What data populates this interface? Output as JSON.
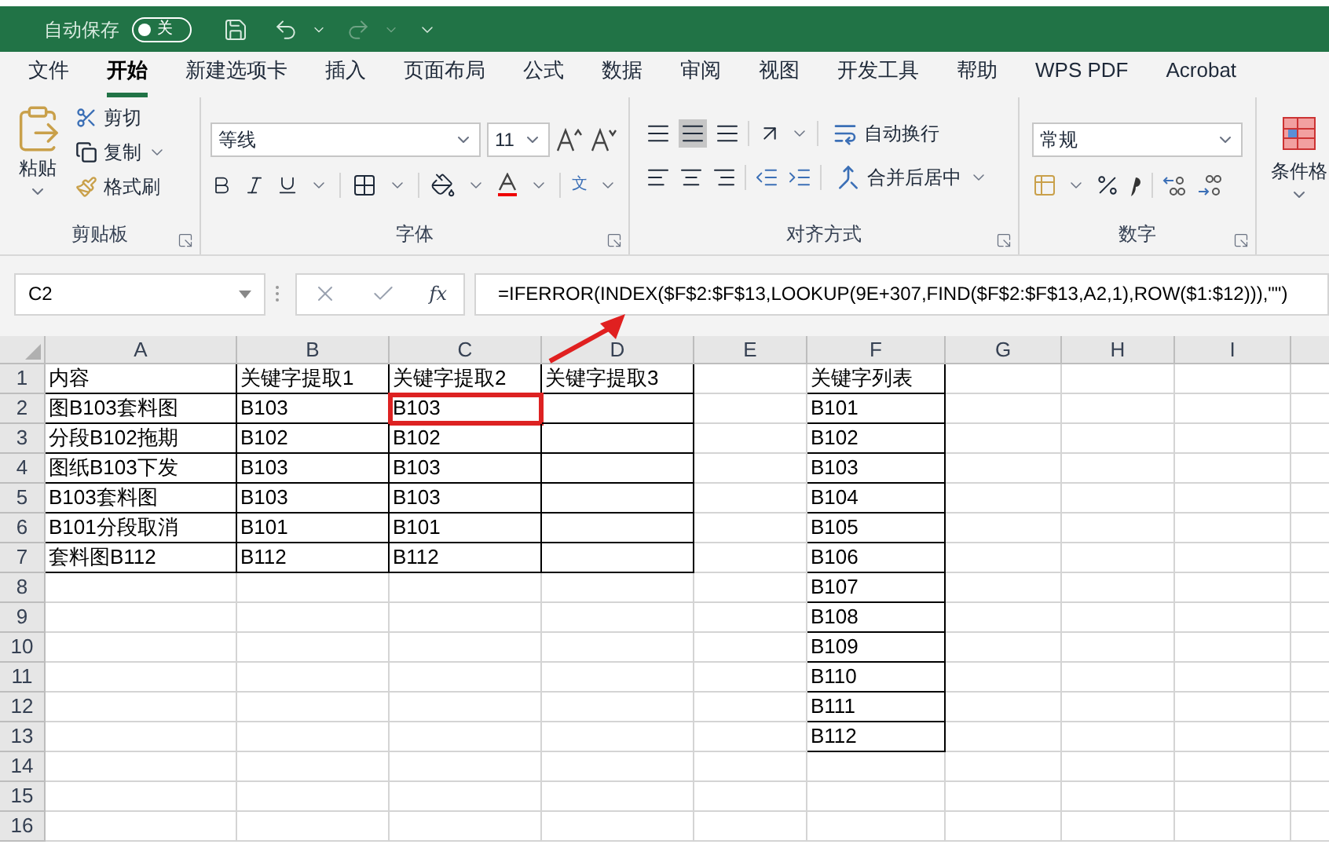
{
  "title_bar": {
    "autosave_label": "自动保存",
    "autosave_toggle": {
      "on": false,
      "label": "关"
    }
  },
  "ribbon_tabs": [
    {
      "label": "文件",
      "selected": false
    },
    {
      "label": "开始",
      "selected": true
    },
    {
      "label": "新建选项卡",
      "selected": false
    },
    {
      "label": "插入",
      "selected": false
    },
    {
      "label": "页面布局",
      "selected": false
    },
    {
      "label": "公式",
      "selected": false
    },
    {
      "label": "数据",
      "selected": false
    },
    {
      "label": "审阅",
      "selected": false
    },
    {
      "label": "视图",
      "selected": false
    },
    {
      "label": "开发工具",
      "selected": false
    },
    {
      "label": "帮助",
      "selected": false
    },
    {
      "label": "WPS PDF",
      "selected": false
    },
    {
      "label": "Acrobat",
      "selected": false
    }
  ],
  "clipboard_group": {
    "title": "剪贴板",
    "paste": "粘贴",
    "cut": "剪切",
    "copy": "复制",
    "format_painter": "格式刷"
  },
  "font_group": {
    "title": "字体",
    "font_name": "等线",
    "font_size": "11",
    "phonetic_label": "文"
  },
  "alignment_group": {
    "title": "对齐方式",
    "wrap_text": "自动换行",
    "merge_center": "合并后居中"
  },
  "number_group": {
    "title": "数字",
    "format": "常规"
  },
  "styles_group": {
    "conditional_format": "条件格"
  },
  "formula_bar": {
    "name_box": "C2",
    "function_label": "fx",
    "formula": "=IFERROR(INDEX($F$2:$F$13,LOOKUP(9E+307,FIND($F$2:$F$13,A2,1),ROW($1:$12))),\"\")"
  },
  "sheet": {
    "columns": [
      "A",
      "B",
      "C",
      "D",
      "E",
      "F",
      "G",
      "H",
      "I"
    ],
    "rows": [
      {
        "number": "1",
        "cells": [
          {
            "text": "内容",
            "boxed": true,
            "highlighted": false
          },
          {
            "text": "关键字提取1",
            "boxed": true,
            "highlighted": false
          },
          {
            "text": "关键字提取2",
            "boxed": true,
            "highlighted": false
          },
          {
            "text": "关键字提取3",
            "boxed": true,
            "highlighted": false
          },
          {
            "boxed": false,
            "highlighted": false
          },
          {
            "text": "关键字列表",
            "boxed": true,
            "highlighted": false
          }
        ]
      },
      {
        "number": "2",
        "cells": [
          {
            "text": "图B103套料图",
            "boxed": true,
            "highlighted": false
          },
          {
            "text": "B103",
            "boxed": true,
            "highlighted": false
          },
          {
            "text": "B103",
            "boxed": true,
            "highlighted": true
          },
          {
            "boxed": true,
            "highlighted": false
          },
          {
            "boxed": false,
            "highlighted": false
          },
          {
            "text": "B101",
            "boxed": true,
            "highlighted": false
          }
        ]
      },
      {
        "number": "3",
        "cells": [
          {
            "text": "分段B102拖期",
            "boxed": true,
            "highlighted": false
          },
          {
            "text": "B102",
            "boxed": true,
            "highlighted": false
          },
          {
            "text": "B102",
            "boxed": true,
            "highlighted": false
          },
          {
            "boxed": true,
            "highlighted": false
          },
          {
            "boxed": false,
            "highlighted": false
          },
          {
            "text": "B102",
            "boxed": true,
            "highlighted": false
          }
        ]
      },
      {
        "number": "4",
        "cells": [
          {
            "text": "图纸B103下发",
            "boxed": true,
            "highlighted": false
          },
          {
            "text": "B103",
            "boxed": true,
            "highlighted": false
          },
          {
            "text": "B103",
            "boxed": true,
            "highlighted": false
          },
          {
            "boxed": true,
            "highlighted": false
          },
          {
            "boxed": false,
            "highlighted": false
          },
          {
            "text": "B103",
            "boxed": true,
            "highlighted": false
          }
        ]
      },
      {
        "number": "5",
        "cells": [
          {
            "text": "B103套料图",
            "boxed": true,
            "highlighted": false
          },
          {
            "text": "B103",
            "boxed": true,
            "highlighted": false
          },
          {
            "text": "B103",
            "boxed": true,
            "highlighted": false
          },
          {
            "boxed": true,
            "highlighted": false
          },
          {
            "boxed": false,
            "highlighted": false
          },
          {
            "text": "B104",
            "boxed": true,
            "highlighted": false
          }
        ]
      },
      {
        "number": "6",
        "cells": [
          {
            "text": "B101分段取消",
            "boxed": true,
            "highlighted": false
          },
          {
            "text": "B101",
            "boxed": true,
            "highlighted": false
          },
          {
            "text": "B101",
            "boxed": true,
            "highlighted": false
          },
          {
            "boxed": true,
            "highlighted": false
          },
          {
            "boxed": false,
            "highlighted": false
          },
          {
            "text": "B105",
            "boxed": true,
            "highlighted": false
          }
        ]
      },
      {
        "number": "7",
        "cells": [
          {
            "text": "套料图B112",
            "boxed": true,
            "highlighted": false
          },
          {
            "text": "B112",
            "boxed": true,
            "highlighted": false
          },
          {
            "text": "B112",
            "boxed": true,
            "highlighted": false
          },
          {
            "boxed": true,
            "highlighted": false
          },
          {
            "boxed": false,
            "highlighted": false
          },
          {
            "text": "B106",
            "boxed": true,
            "highlighted": false
          }
        ]
      },
      {
        "number": "8",
        "cells": [
          {
            "boxed": false,
            "highlighted": false
          },
          {
            "boxed": false,
            "highlighted": false
          },
          {
            "boxed": false,
            "highlighted": false
          },
          {
            "boxed": false,
            "highlighted": false
          },
          {
            "boxed": false,
            "highlighted": false
          },
          {
            "text": "B107",
            "boxed": true,
            "highlighted": false
          }
        ]
      },
      {
        "number": "9",
        "cells": [
          {
            "boxed": false,
            "highlighted": false
          },
          {
            "boxed": false,
            "highlighted": false
          },
          {
            "boxed": false,
            "highlighted": false
          },
          {
            "boxed": false,
            "highlighted": false
          },
          {
            "boxed": false,
            "highlighted": false
          },
          {
            "text": "B108",
            "boxed": true,
            "highlighted": false
          }
        ]
      },
      {
        "number": "10",
        "cells": [
          {
            "boxed": false,
            "highlighted": false
          },
          {
            "boxed": false,
            "highlighted": false
          },
          {
            "boxed": false,
            "highlighted": false
          },
          {
            "boxed": false,
            "highlighted": false
          },
          {
            "boxed": false,
            "highlighted": false
          },
          {
            "text": "B109",
            "boxed": true,
            "highlighted": false
          }
        ]
      },
      {
        "number": "11",
        "cells": [
          {
            "boxed": false,
            "highlighted": false
          },
          {
            "boxed": false,
            "highlighted": false
          },
          {
            "boxed": false,
            "highlighted": false
          },
          {
            "boxed": false,
            "highlighted": false
          },
          {
            "boxed": false,
            "highlighted": false
          },
          {
            "text": "B110",
            "boxed": true,
            "highlighted": false
          }
        ]
      },
      {
        "number": "12",
        "cells": [
          {
            "boxed": false,
            "highlighted": false
          },
          {
            "boxed": false,
            "highlighted": false
          },
          {
            "boxed": false,
            "highlighted": false
          },
          {
            "boxed": false,
            "highlighted": false
          },
          {
            "boxed": false,
            "highlighted": false
          },
          {
            "text": "B111",
            "boxed": true,
            "highlighted": false
          }
        ]
      },
      {
        "number": "13",
        "cells": [
          {
            "boxed": false,
            "highlighted": false
          },
          {
            "boxed": false,
            "highlighted": false
          },
          {
            "boxed": false,
            "highlighted": false
          },
          {
            "boxed": false,
            "highlighted": false
          },
          {
            "boxed": false,
            "highlighted": false
          },
          {
            "text": "B112",
            "boxed": true,
            "highlighted": false
          }
        ]
      },
      {
        "number": "14",
        "cells": [
          {
            "boxed": false,
            "highlighted": false
          },
          {
            "boxed": false,
            "highlighted": false
          },
          {
            "boxed": false,
            "highlighted": false
          },
          {
            "boxed": false,
            "highlighted": false
          },
          {
            "boxed": false,
            "highlighted": false
          },
          {
            "boxed": false,
            "highlighted": false
          }
        ]
      },
      {
        "number": "15",
        "cells": [
          {
            "boxed": false,
            "highlighted": false
          },
          {
            "boxed": false,
            "highlighted": false
          },
          {
            "boxed": false,
            "highlighted": false
          },
          {
            "boxed": false,
            "highlighted": false
          },
          {
            "boxed": false,
            "highlighted": false
          },
          {
            "boxed": false,
            "highlighted": false
          }
        ]
      },
      {
        "number": "16",
        "cells": [
          {
            "boxed": false,
            "highlighted": false
          },
          {
            "boxed": false,
            "highlighted": false
          },
          {
            "boxed": false,
            "highlighted": false
          },
          {
            "boxed": false,
            "highlighted": false
          },
          {
            "boxed": false,
            "highlighted": false
          },
          {
            "boxed": false,
            "highlighted": false
          }
        ]
      }
    ]
  }
}
